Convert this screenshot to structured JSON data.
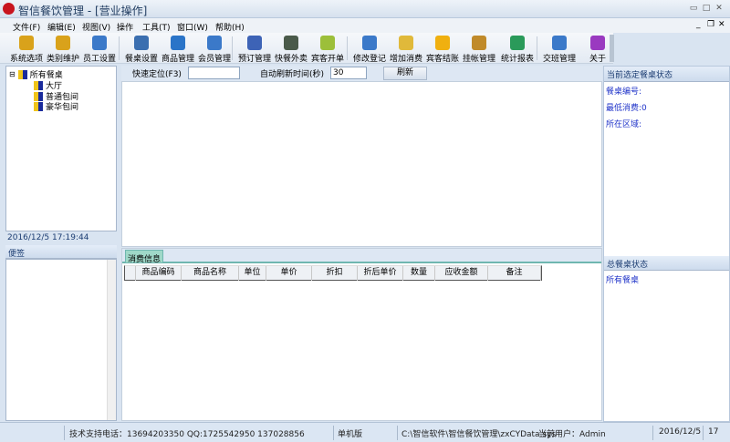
{
  "window": {
    "title": "智信餐饮管理 - [营业操作]"
  },
  "menu": [
    "文件(F)",
    "编辑(E)",
    "视图(V)",
    "操作",
    "工具(T)",
    "窗口(W)",
    "帮助(H)"
  ],
  "toolbar": [
    {
      "label": "系统选项",
      "icon": "hammer-icon",
      "color": "#d9a21b"
    },
    {
      "label": "类别维护",
      "icon": "hammer-icon",
      "color": "#d9a21b"
    },
    {
      "label": "员工设置",
      "icon": "user-icon",
      "color": "#3b79c9"
    },
    {
      "label": "餐桌设置",
      "icon": "table-icon",
      "color": "#3b6fb0"
    },
    {
      "label": "商品管理",
      "icon": "box-icon",
      "color": "#2a74c8"
    },
    {
      "label": "会员管理",
      "icon": "member-icon",
      "color": "#3b79c9"
    },
    {
      "label": "预订管理",
      "icon": "stapler-icon",
      "color": "#3d63b6"
    },
    {
      "label": "快餐外卖",
      "icon": "phone-icon",
      "color": "#4a5a4a"
    },
    {
      "label": "宾客开单",
      "icon": "gift-icon",
      "color": "#9cbf3a"
    },
    {
      "label": "修改登记",
      "icon": "user-edit-icon",
      "color": "#3b79c9"
    },
    {
      "label": "增加消费",
      "icon": "add-folder-icon",
      "color": "#e0b93a"
    },
    {
      "label": "宾客结账",
      "icon": "coin-icon",
      "color": "#f0b010"
    },
    {
      "label": "挂帐管理",
      "icon": "money-bag-icon",
      "color": "#c08a2a"
    },
    {
      "label": "统计报表",
      "icon": "chart-icon",
      "color": "#2a9a5a"
    },
    {
      "label": "交班管理",
      "icon": "users-icon",
      "color": "#3b79c9"
    },
    {
      "label": "关于",
      "icon": "help-icon",
      "color": "#9a3ac0"
    }
  ],
  "tree": {
    "root": "所有餐桌",
    "children": [
      "大厅",
      "普通包间",
      "豪华包间"
    ]
  },
  "left": {
    "datetime": "2016/12/5  17:19:44",
    "notes_header": "便签"
  },
  "search": {
    "quick_label": "快速定位(F3)",
    "quick_value": "",
    "refresh_label": "自动刷新时间(秒)",
    "refresh_value": "30",
    "refresh_button": "刷新"
  },
  "consumption": {
    "tab": "消费信息",
    "columns": [
      "商品编码",
      "商品名称",
      "单位",
      "单价",
      "折扣",
      "折后单价",
      "数量",
      "应收金额",
      "备注"
    ]
  },
  "right": {
    "current_header": "当前选定餐桌状态",
    "table_no": "餐桌编号:",
    "min_spend": "最低消费:0",
    "area": "所在区域:",
    "total_header": "总餐桌状态",
    "all_tables": "所有餐桌"
  },
  "status": {
    "support": "技术支持电话：13694203350 QQ:1725542950 137028856",
    "edition": "单机版",
    "path": "C:\\智信软件\\智信餐饮管理\\zxCYData.sys",
    "user": "当前用户：Admin",
    "date": "2016/12/5",
    "time": "17"
  }
}
